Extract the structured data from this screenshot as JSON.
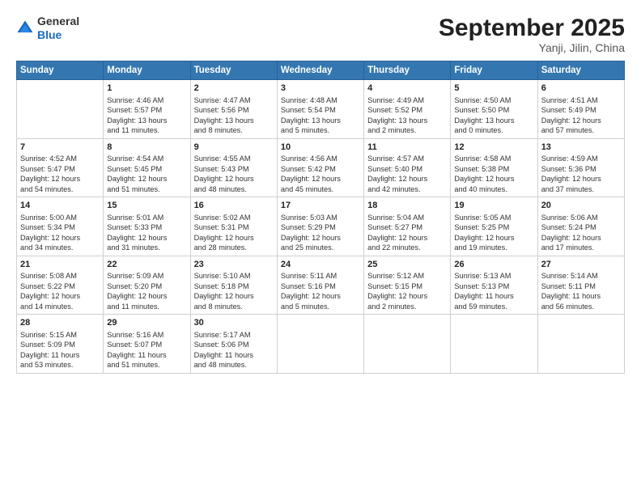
{
  "header": {
    "logo_general": "General",
    "logo_blue": "Blue",
    "month_title": "September 2025",
    "location": "Yanji, Jilin, China"
  },
  "days_of_week": [
    "Sunday",
    "Monday",
    "Tuesday",
    "Wednesday",
    "Thursday",
    "Friday",
    "Saturday"
  ],
  "weeks": [
    [
      {
        "day": "",
        "content": ""
      },
      {
        "day": "1",
        "content": "Sunrise: 4:46 AM\nSunset: 5:57 PM\nDaylight: 13 hours\nand 11 minutes."
      },
      {
        "day": "2",
        "content": "Sunrise: 4:47 AM\nSunset: 5:56 PM\nDaylight: 13 hours\nand 8 minutes."
      },
      {
        "day": "3",
        "content": "Sunrise: 4:48 AM\nSunset: 5:54 PM\nDaylight: 13 hours\nand 5 minutes."
      },
      {
        "day": "4",
        "content": "Sunrise: 4:49 AM\nSunset: 5:52 PM\nDaylight: 13 hours\nand 2 minutes."
      },
      {
        "day": "5",
        "content": "Sunrise: 4:50 AM\nSunset: 5:50 PM\nDaylight: 13 hours\nand 0 minutes."
      },
      {
        "day": "6",
        "content": "Sunrise: 4:51 AM\nSunset: 5:49 PM\nDaylight: 12 hours\nand 57 minutes."
      }
    ],
    [
      {
        "day": "7",
        "content": "Sunrise: 4:52 AM\nSunset: 5:47 PM\nDaylight: 12 hours\nand 54 minutes."
      },
      {
        "day": "8",
        "content": "Sunrise: 4:54 AM\nSunset: 5:45 PM\nDaylight: 12 hours\nand 51 minutes."
      },
      {
        "day": "9",
        "content": "Sunrise: 4:55 AM\nSunset: 5:43 PM\nDaylight: 12 hours\nand 48 minutes."
      },
      {
        "day": "10",
        "content": "Sunrise: 4:56 AM\nSunset: 5:42 PM\nDaylight: 12 hours\nand 45 minutes."
      },
      {
        "day": "11",
        "content": "Sunrise: 4:57 AM\nSunset: 5:40 PM\nDaylight: 12 hours\nand 42 minutes."
      },
      {
        "day": "12",
        "content": "Sunrise: 4:58 AM\nSunset: 5:38 PM\nDaylight: 12 hours\nand 40 minutes."
      },
      {
        "day": "13",
        "content": "Sunrise: 4:59 AM\nSunset: 5:36 PM\nDaylight: 12 hours\nand 37 minutes."
      }
    ],
    [
      {
        "day": "14",
        "content": "Sunrise: 5:00 AM\nSunset: 5:34 PM\nDaylight: 12 hours\nand 34 minutes."
      },
      {
        "day": "15",
        "content": "Sunrise: 5:01 AM\nSunset: 5:33 PM\nDaylight: 12 hours\nand 31 minutes."
      },
      {
        "day": "16",
        "content": "Sunrise: 5:02 AM\nSunset: 5:31 PM\nDaylight: 12 hours\nand 28 minutes."
      },
      {
        "day": "17",
        "content": "Sunrise: 5:03 AM\nSunset: 5:29 PM\nDaylight: 12 hours\nand 25 minutes."
      },
      {
        "day": "18",
        "content": "Sunrise: 5:04 AM\nSunset: 5:27 PM\nDaylight: 12 hours\nand 22 minutes."
      },
      {
        "day": "19",
        "content": "Sunrise: 5:05 AM\nSunset: 5:25 PM\nDaylight: 12 hours\nand 19 minutes."
      },
      {
        "day": "20",
        "content": "Sunrise: 5:06 AM\nSunset: 5:24 PM\nDaylight: 12 hours\nand 17 minutes."
      }
    ],
    [
      {
        "day": "21",
        "content": "Sunrise: 5:08 AM\nSunset: 5:22 PM\nDaylight: 12 hours\nand 14 minutes."
      },
      {
        "day": "22",
        "content": "Sunrise: 5:09 AM\nSunset: 5:20 PM\nDaylight: 12 hours\nand 11 minutes."
      },
      {
        "day": "23",
        "content": "Sunrise: 5:10 AM\nSunset: 5:18 PM\nDaylight: 12 hours\nand 8 minutes."
      },
      {
        "day": "24",
        "content": "Sunrise: 5:11 AM\nSunset: 5:16 PM\nDaylight: 12 hours\nand 5 minutes."
      },
      {
        "day": "25",
        "content": "Sunrise: 5:12 AM\nSunset: 5:15 PM\nDaylight: 12 hours\nand 2 minutes."
      },
      {
        "day": "26",
        "content": "Sunrise: 5:13 AM\nSunset: 5:13 PM\nDaylight: 11 hours\nand 59 minutes."
      },
      {
        "day": "27",
        "content": "Sunrise: 5:14 AM\nSunset: 5:11 PM\nDaylight: 11 hours\nand 56 minutes."
      }
    ],
    [
      {
        "day": "28",
        "content": "Sunrise: 5:15 AM\nSunset: 5:09 PM\nDaylight: 11 hours\nand 53 minutes."
      },
      {
        "day": "29",
        "content": "Sunrise: 5:16 AM\nSunset: 5:07 PM\nDaylight: 11 hours\nand 51 minutes."
      },
      {
        "day": "30",
        "content": "Sunrise: 5:17 AM\nSunset: 5:06 PM\nDaylight: 11 hours\nand 48 minutes."
      },
      {
        "day": "",
        "content": ""
      },
      {
        "day": "",
        "content": ""
      },
      {
        "day": "",
        "content": ""
      },
      {
        "day": "",
        "content": ""
      }
    ]
  ]
}
